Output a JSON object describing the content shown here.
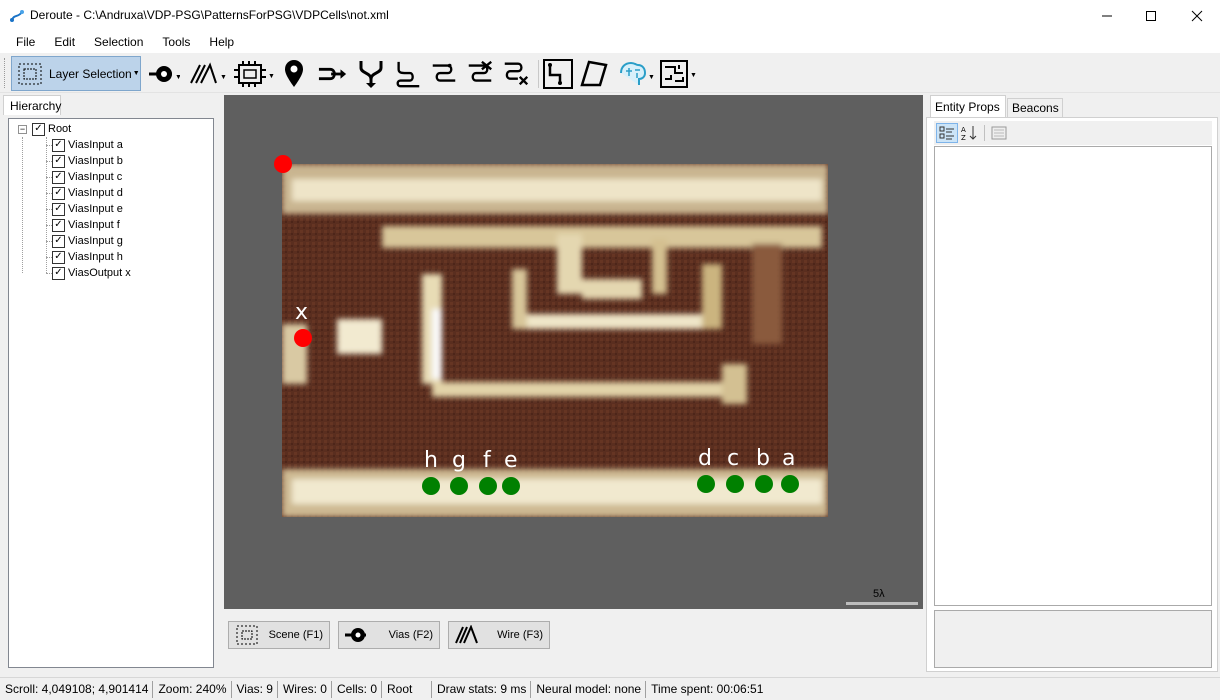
{
  "window": {
    "title": "Deroute - C:\\Andruxa\\VDP-PSG\\PatternsForPSG\\VDPCells\\not.xml",
    "minimize": "─",
    "maximize": "☐",
    "close": "✕"
  },
  "menu": [
    "File",
    "Edit",
    "Selection",
    "Tools",
    "Help"
  ],
  "toolbar": {
    "layer_selection_label": "Layer Selection",
    "icons": [
      "layer-select-icon",
      "vias-icon",
      "wire-icon",
      "cell-icon",
      "beacon-icon",
      "input-wire-icon",
      "fork-icon",
      "route-icon",
      "route-alt-icon",
      "route-cross-icon",
      "route-delete-icon",
      "tool-path-icon",
      "tool-polygon-icon",
      "neural-icon",
      "schematic-icon"
    ]
  },
  "left_panel": {
    "tab": "Hierarchy",
    "root": "Root",
    "items": [
      "ViasInput a",
      "ViasInput b",
      "ViasInput c",
      "ViasInput d",
      "ViasInput e",
      "ViasInput f",
      "ViasInput g",
      "ViasInput h",
      "ViasOutput x"
    ]
  },
  "canvas": {
    "pins": [
      {
        "label": "x",
        "color": "#ff0000"
      },
      {
        "label": "h",
        "color": "#008000"
      },
      {
        "label": "g",
        "color": "#008000"
      },
      {
        "label": "f",
        "color": "#008000"
      },
      {
        "label": "e",
        "color": "#008000"
      },
      {
        "label": "d",
        "color": "#008000"
      },
      {
        "label": "c",
        "color": "#008000"
      },
      {
        "label": "b",
        "color": "#008000"
      },
      {
        "label": "a",
        "color": "#008000"
      }
    ],
    "origin_marker_color": "#ff0000",
    "scale_label": "5λ"
  },
  "mode_buttons": {
    "scene": "Scene (F1)",
    "vias": "Vias (F2)",
    "wire": "Wire (F3)"
  },
  "right_panel": {
    "tabs": [
      "Entity Props",
      "Beacons"
    ]
  },
  "status": {
    "scroll": "Scroll:   4,049108; 4,901414",
    "zoom": "Zoom:   240%",
    "vias": "Vias:   9",
    "wires": "Wires:   0",
    "cells": "Cells:   0",
    "layer": "Root",
    "draw_stats": "Draw stats:   9 ms",
    "neural": "Neural model:   none",
    "time": "Time spent:   00:06:51"
  }
}
